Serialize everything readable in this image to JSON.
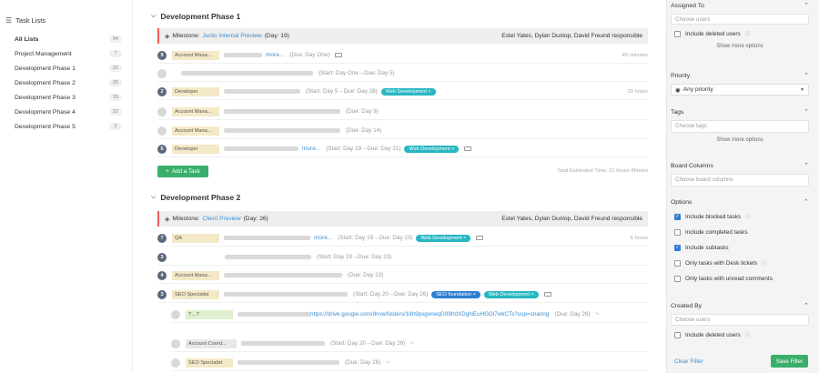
{
  "sidebar": {
    "title": "Task Lists",
    "items": [
      {
        "label": "All Lists",
        "count": "94"
      },
      {
        "label": "Project Management",
        "count": "7"
      },
      {
        "label": "Development Phase 1",
        "count": "22"
      },
      {
        "label": "Development Phase 2",
        "count": "26"
      },
      {
        "label": "Development Phase 3",
        "count": "15"
      },
      {
        "label": "Development Phase 4",
        "count": "22"
      },
      {
        "label": "Development Phase 5",
        "count": "2"
      }
    ]
  },
  "phase1": {
    "title": "Development Phase 1",
    "milestone": {
      "prefix": "Milestone:",
      "name": "Junto Internal Preview",
      "day": "(Day: 19)",
      "responsible": "Estel Yates, Dylan Dunlop, David Freund responsible"
    },
    "rows": [
      {
        "num": "9",
        "role": "Account Mana...",
        "more": "more...",
        "meta": "(Due: Day One)",
        "estimate": "45 minutes"
      },
      {
        "meta": "(Start: Day One→Due: Day 5)"
      },
      {
        "num": "2",
        "role": "Developer",
        "meta": "(Start: Day 5→Due: Day 28)",
        "tag": "Web Development ×",
        "estimate": "20 hours"
      },
      {
        "role": "Account Mana...",
        "meta": "(Due: Day 9)"
      },
      {
        "role": "Account Mana...",
        "meta": "(Due: Day 14)"
      },
      {
        "num": "5",
        "role": "Developer",
        "more": "more...",
        "meta": "(Start: Day 19→Due: Day 21)",
        "tag": "Web Development ×"
      }
    ],
    "add_task": "Add a Task",
    "total": "Total Estimated Time: 21 hours 45mins"
  },
  "phase2": {
    "title": "Development Phase 2",
    "milestone": {
      "prefix": "Milestone:",
      "name": "Client Preview",
      "day": "(Day: 26)",
      "responsible": "Estel Yates, Dylan Dunlop, David Freund responsible"
    },
    "rows": [
      {
        "num": "7",
        "role": "QA",
        "more": "more...",
        "meta": "(Start: Day 19→Due: Day 23)",
        "tag": "Web Development ×",
        "estimate": "5 hours"
      },
      {
        "num": "3",
        "meta": "(Start: Day 19→Due: Day 23)"
      },
      {
        "num": "4",
        "role": "Account Mana...",
        "meta": "(Due: Day 23)"
      },
      {
        "num": "3",
        "role": "SEO Specialist",
        "meta": "(Start: Day 20→Due: Day 26)",
        "tag1": "SEO foundation ×",
        "tag2": "Web Development ×"
      },
      {
        "role": "?…?",
        "url": "https://drive.google.com/drive/folders/18h9pxgoneqG99frdXDgNEuHGGl7wkCTs?usp=sharing",
        "meta": "(Due: Day 26)"
      },
      {
        "role": "Account Coord...",
        "meta": "(Start: Day 20→Due: Day 26)"
      },
      {
        "role": "SEO Specialist",
        "meta": "(Due: Day 26)"
      }
    ]
  },
  "panel": {
    "assigned_to": {
      "title": "Assigned To",
      "placeholder": "Choose users",
      "include_deleted": "Include deleted users",
      "show_more": "Show more options"
    },
    "priority": {
      "title": "Priority",
      "value": "Any priority"
    },
    "tags": {
      "title": "Tags",
      "placeholder": "Choose tags",
      "show_more": "Show more options"
    },
    "board_columns": {
      "title": "Board Columns",
      "placeholder": "Choose board columns"
    },
    "options": {
      "title": "Options",
      "items": [
        {
          "label": "Include blocked tasks",
          "checked": true
        },
        {
          "label": "Include completed tasks",
          "checked": false
        },
        {
          "label": "Include subtasks",
          "checked": true
        },
        {
          "label": "Only tasks with Desk tickets",
          "checked": false
        },
        {
          "label": "Only tasks with unread comments",
          "checked": false
        }
      ]
    },
    "created_by": {
      "title": "Created By",
      "placeholder": "Choose users",
      "include_deleted": "Include deleted users"
    },
    "clear_filter": "Clear Filter",
    "save_filter": "Save Filter"
  }
}
